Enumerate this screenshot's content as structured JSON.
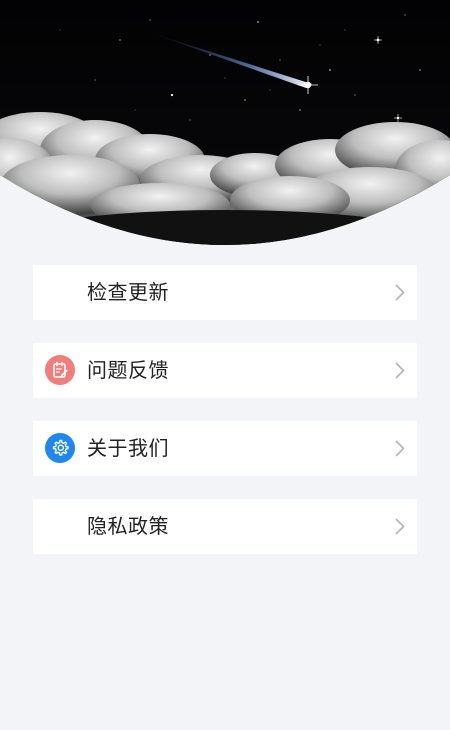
{
  "colors": {
    "page_background": "#f2f4f8",
    "card_background": "#ffffff",
    "label_text": "#222222",
    "chevron": "#b7b7b7",
    "feedback_icon_bg": "#f07f7b",
    "about_icon_bg": "#1f86f2"
  },
  "header": {
    "image_icon": "night-sky-shooting-star-clouds"
  },
  "menu": {
    "items": [
      {
        "label": "检查更新",
        "icon": "none"
      },
      {
        "label": "问题反馈",
        "icon": "feedback-notepad-icon"
      },
      {
        "label": "关于我们",
        "icon": "gear-icon"
      },
      {
        "label": "隐私政策",
        "icon": "none"
      }
    ]
  }
}
